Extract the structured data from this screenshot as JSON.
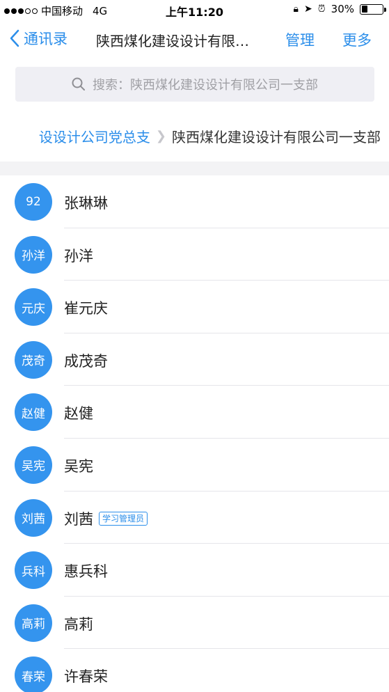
{
  "status_bar": {
    "carrier": "中国移动",
    "network": "4G",
    "time": "上午11:20",
    "battery": "30%",
    "battery_level": 0.3
  },
  "nav": {
    "back_label": "通讯录",
    "title": "陕西煤化建设设计有限…",
    "manage_label": "管理",
    "more_label": "更多"
  },
  "search": {
    "placeholder": "搜索：陕西煤化建设设计有限公司一支部"
  },
  "breadcrumb": {
    "parent": "设设计公司党总支",
    "current": "陕西煤化建设设计有限公司一支部"
  },
  "contacts": [
    {
      "avatar": "92",
      "name": "张琳琳",
      "badge": ""
    },
    {
      "avatar": "孙洋",
      "name": "孙洋",
      "badge": ""
    },
    {
      "avatar": "元庆",
      "name": "崔元庆",
      "badge": ""
    },
    {
      "avatar": "茂奇",
      "name": "成茂奇",
      "badge": ""
    },
    {
      "avatar": "赵健",
      "name": "赵健",
      "badge": ""
    },
    {
      "avatar": "吴宪",
      "name": "吴宪",
      "badge": ""
    },
    {
      "avatar": "刘茜",
      "name": "刘茜",
      "badge": "学习管理员"
    },
    {
      "avatar": "兵科",
      "name": "惠兵科",
      "badge": ""
    },
    {
      "avatar": "高莉",
      "name": "高莉",
      "badge": ""
    },
    {
      "avatar": "春荣",
      "name": "许春荣",
      "badge": ""
    }
  ],
  "colors": {
    "accent": "#2b8eea",
    "avatar_bg": "#3494ee"
  }
}
